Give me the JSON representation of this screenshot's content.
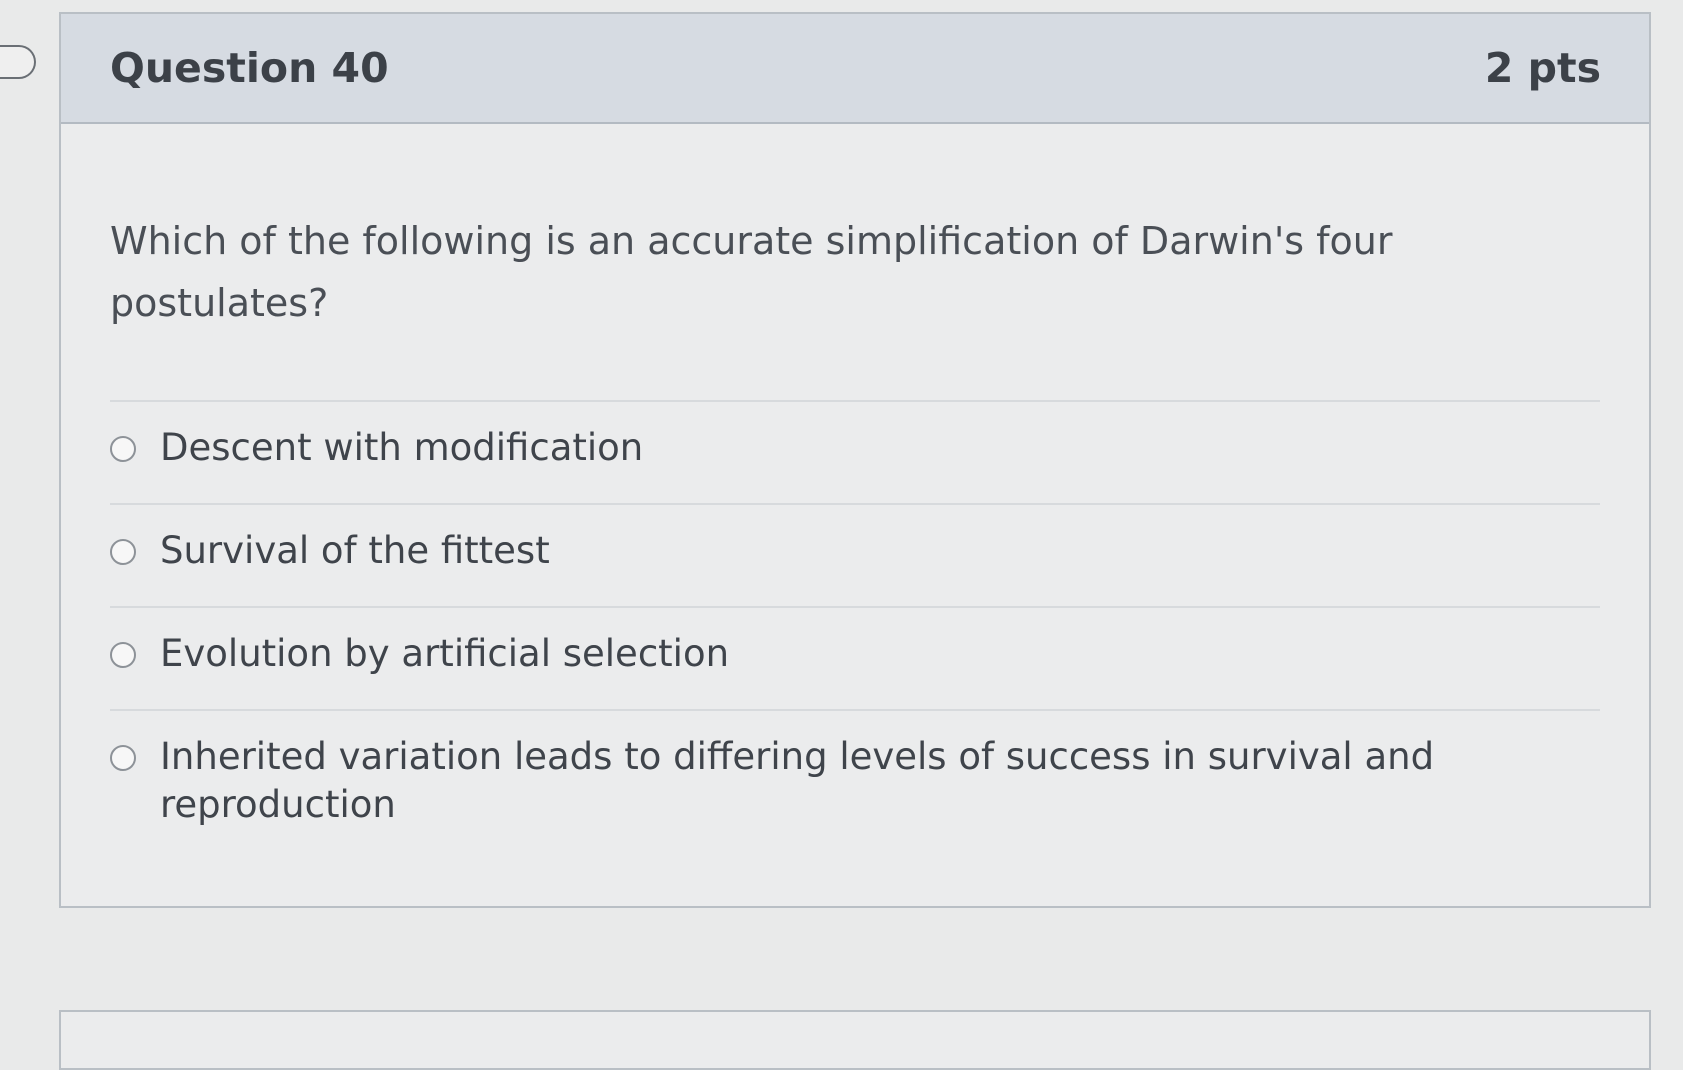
{
  "question": {
    "title": "Question 40",
    "points": "2 pts",
    "text": "Which of the following is an accurate simplification of Darwin's four postulates?",
    "answers": [
      {
        "label": "Descent with modification"
      },
      {
        "label": "Survival of the fittest"
      },
      {
        "label": "Evolution by artificial selection"
      },
      {
        "label": "Inherited variation leads to differing levels of success in survival and reproduction"
      }
    ]
  }
}
